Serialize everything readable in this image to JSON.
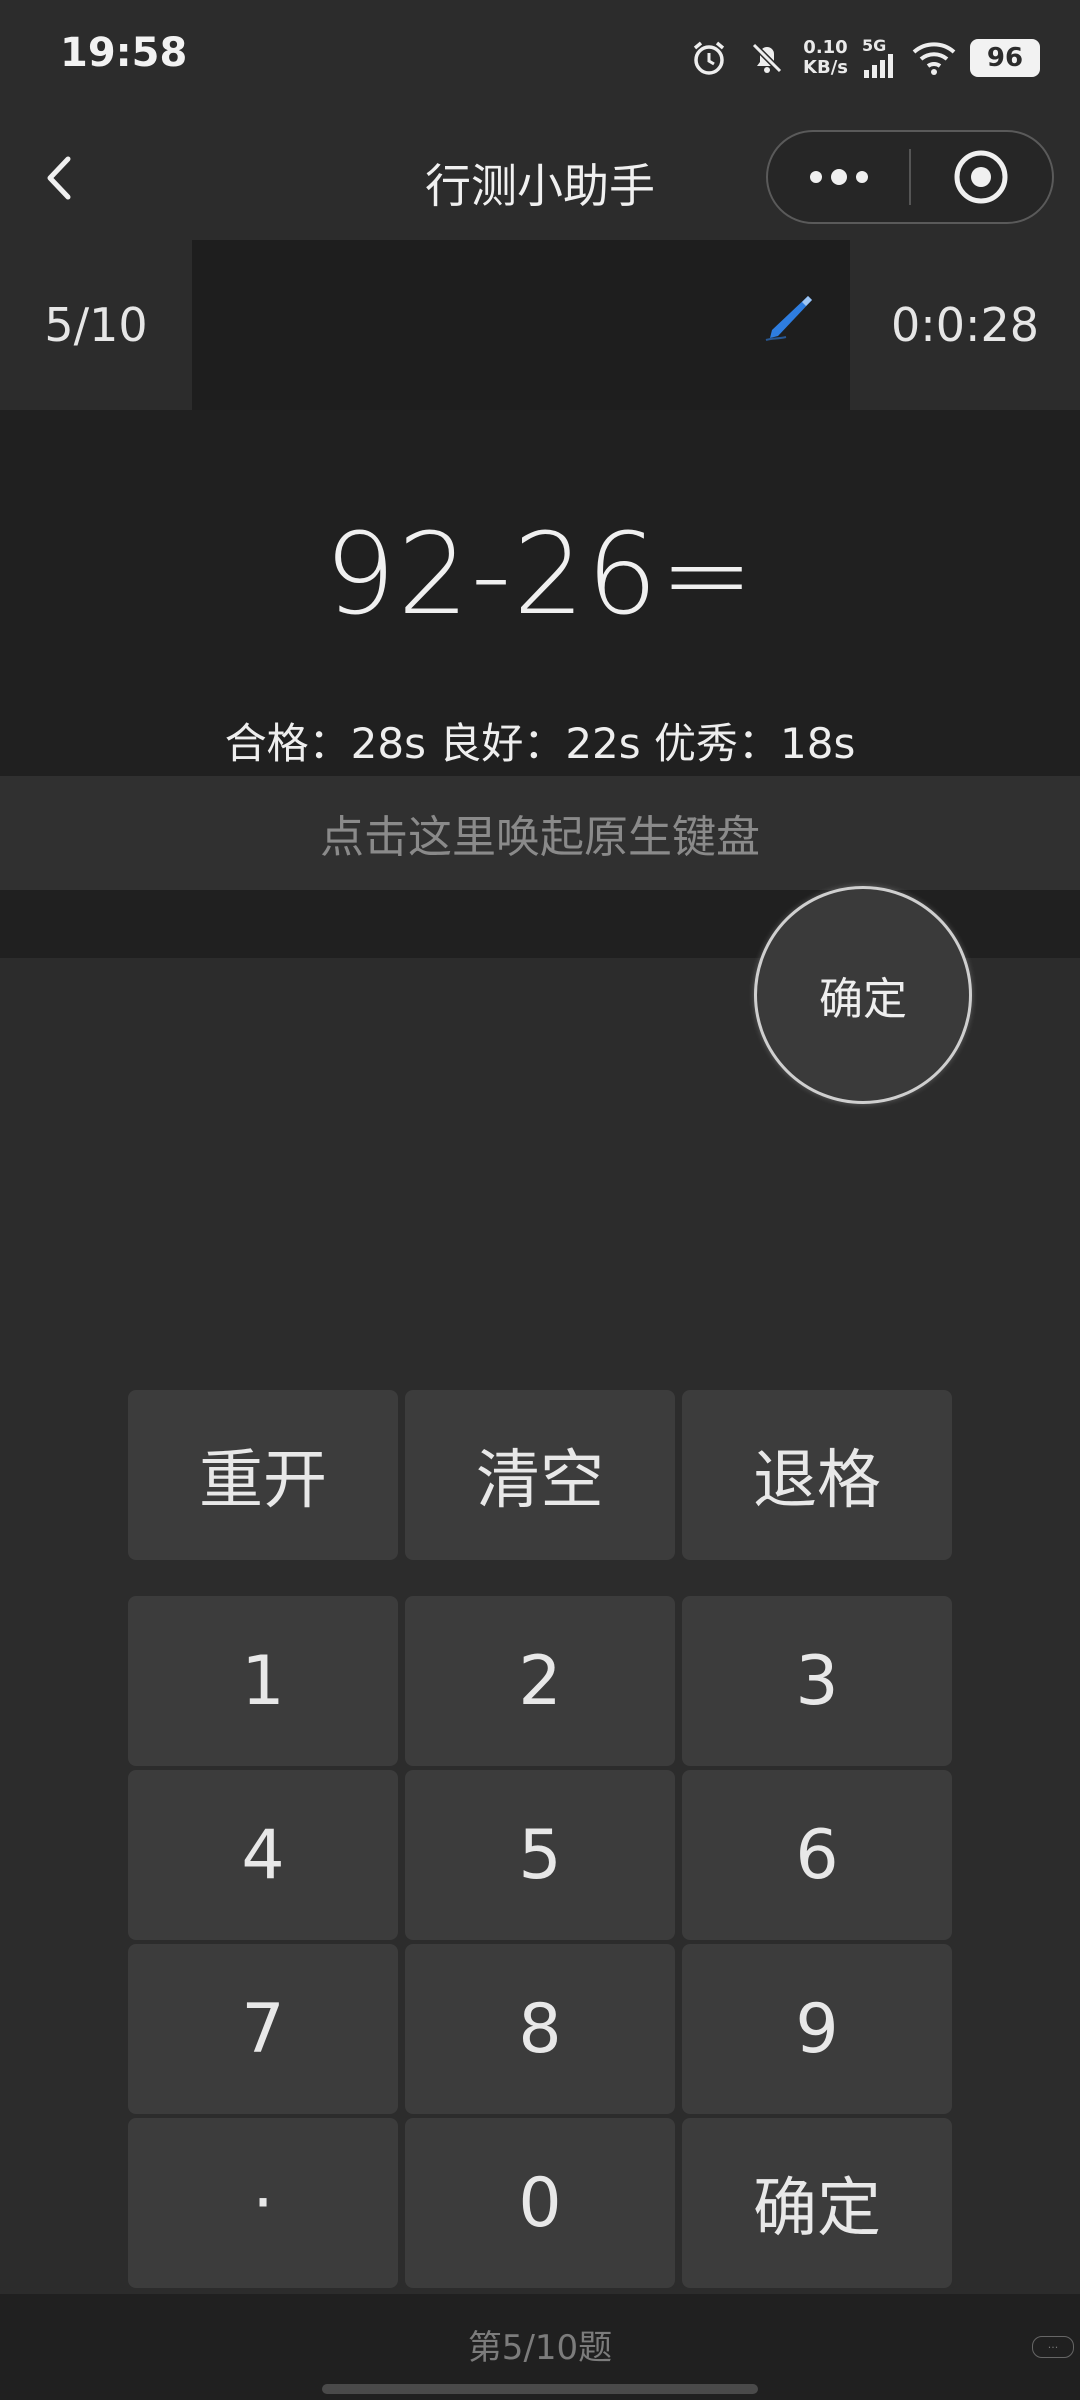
{
  "status_bar": {
    "time": "19:58",
    "net_speed_value": "0.10",
    "net_speed_unit": "KB/s",
    "network_type": "5G",
    "battery": "96",
    "icons": [
      "alarm-icon",
      "mute-bell-icon",
      "signal-icon",
      "wifi-icon",
      "battery-icon"
    ]
  },
  "nav": {
    "title": "行测小助手",
    "back_icon": "chevron-left-icon",
    "more_icon": "more-dots-icon",
    "close_icon": "target-icon"
  },
  "progress": {
    "count": "5/10",
    "timer": "0:0:28",
    "pen_icon": "pen-icon"
  },
  "question": {
    "expression": "92-26=",
    "standards": "合格：28s 良好：22s 优秀：18s"
  },
  "keyboard_bar": {
    "placeholder": "点击这里唤起原生键盘"
  },
  "confirm_fab": {
    "label": "确定"
  },
  "keypad": {
    "functions": [
      "重开",
      "清空",
      "退格"
    ],
    "rows": [
      [
        "1",
        "2",
        "3"
      ],
      [
        "4",
        "5",
        "6"
      ],
      [
        "7",
        "8",
        "9"
      ],
      [
        "·",
        "0",
        "确定"
      ]
    ]
  },
  "footer": {
    "text": "第5/10题"
  },
  "colors": {
    "background": "#2c2c2c",
    "panel": "#202020",
    "key": "#3c3c3c",
    "text": "#e8e8e8",
    "muted_text": "#8a8a8a",
    "pen_accent": "#2e7de0"
  }
}
